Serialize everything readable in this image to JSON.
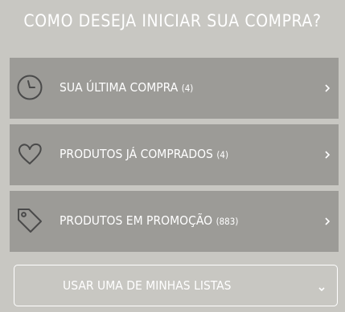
{
  "header": {
    "title": "COMO DESEJA INICIAR SUA COMPRA?"
  },
  "options": [
    {
      "label": "SUA ÚLTIMA COMPRA",
      "count": "(4)",
      "icon": "clock-icon"
    },
    {
      "label": "PRODUTOS JÁ COMPRADOS",
      "count": "(4)",
      "icon": "heart-icon"
    },
    {
      "label": "PRODUTOS EM PROMOÇÃO",
      "count": "(883)",
      "icon": "price-tag-icon"
    }
  ],
  "lists_dropdown": {
    "label": "USAR UMA DE MINHAS LISTAS",
    "icon": "chevron-down-icon"
  },
  "colors": {
    "background": "#c8c7c2",
    "card": "#9c9b97",
    "text": "#ffffff",
    "icon": "#4a4a4a"
  }
}
